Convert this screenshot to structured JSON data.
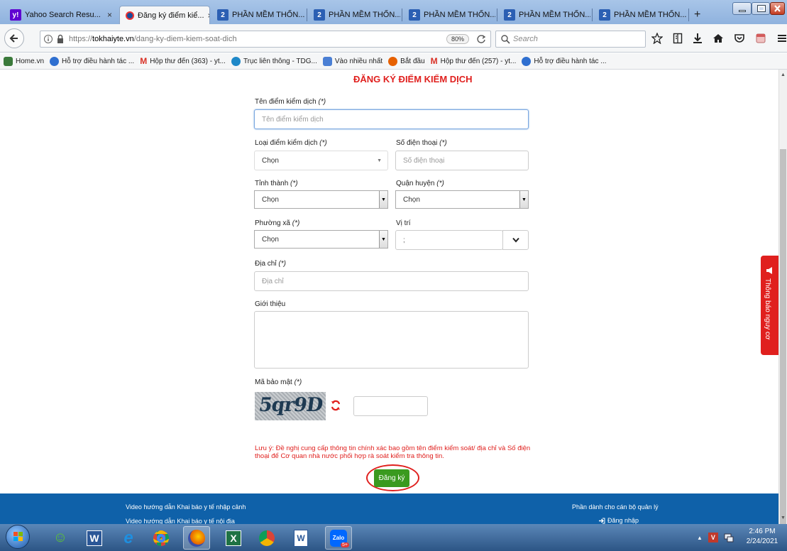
{
  "browser": {
    "tabs": [
      {
        "label": "Yahoo Search Resu...",
        "icon": "yahoo-icon"
      },
      {
        "label": "Đăng ký điểm kiể...",
        "icon": "site-favicon"
      },
      {
        "label": "PHẦN MỀM THỐN...",
        "icon": "doc-icon"
      },
      {
        "label": "PHẦN MỀM THỐN...",
        "icon": "doc-icon"
      },
      {
        "label": "PHẦN MỀM THỐN...",
        "icon": "doc-icon"
      },
      {
        "label": "PHẦN MỀM THỐN...",
        "icon": "doc-icon"
      },
      {
        "label": "PHẦN MỀM THỐN...",
        "icon": "doc-icon"
      }
    ],
    "tab_close": "×",
    "new_tab": "+",
    "url_prefix": "https://",
    "url_host": "tokhaiyte.vn",
    "url_path": "/dang-ky-diem-kiem-soat-dich",
    "zoom": "80%",
    "search_placeholder": "Search",
    "bookmarks": [
      {
        "label": "Home.vn",
        "color": "#3b7a3b"
      },
      {
        "label": "Hỗ trợ điều hành tác ...",
        "color": "#2f6fd0"
      },
      {
        "label": "Hộp thư đến (363) - yt...",
        "color": "#d93025"
      },
      {
        "label": "Trục liên thông - TDG...",
        "color": "#1e88c8"
      },
      {
        "label": "Vào nhiều nhất",
        "color": "#4a7fd4"
      },
      {
        "label": "Bắt đầu",
        "color": "#e66000"
      },
      {
        "label": "Hộp thư đến (257) - yt...",
        "color": "#d93025"
      },
      {
        "label": "Hỗ trợ điều hành tác ...",
        "color": "#2f6fd0"
      }
    ]
  },
  "form": {
    "title": "ĐĂNG KÝ ĐIỂM KIỂM DỊCH",
    "title_color": "#e0201e",
    "name_label": "Tên điểm kiểm dịch",
    "name_placeholder": "Tên điểm kiểm dịch",
    "type_label": "Loại điểm kiểm dịch",
    "type_value": "Chọn",
    "phone_label": "Số điện thoại",
    "phone_placeholder": "Số điện thoại",
    "province_label": "Tỉnh thành",
    "province_value": "Chọn",
    "district_label": "Quận huyện",
    "district_value": "Chọn",
    "ward_label": "Phường xã",
    "ward_value": "Chọn",
    "location_label": "Vị trí",
    "location_value": ";",
    "address_label": "Địa chỉ",
    "address_placeholder": "Địa chỉ",
    "intro_label": "Giới thiệu",
    "captcha_label": "Mã bảo mật",
    "captcha_text": "5qr9D",
    "required_mark": "(*)",
    "note": "Lưu ý: Đề nghị cung cấp thông tin chính xác bao gồm tên điểm kiểm soát/ địa chỉ và Số điện thoại để Cơ quan nhà nước phối hợp rà soát kiểm tra thông tin.",
    "submit_label": "Đăng ký",
    "submit_color": "#3a9a1f"
  },
  "side_tab": {
    "label": "Thông báo nguy cơ",
    "color": "#e0201e"
  },
  "footer": {
    "link_1": "Video hướng dẫn Khai báo y tế nhập cảnh",
    "link_2": "Video hướng dẫn Khai báo y tế nội địa",
    "admin_title": "Phần dành cho cán bộ quản lý",
    "login": "Đăng nhập",
    "color": "#0f61a9"
  },
  "taskbar": {
    "apps": [
      "windows-start",
      "app-icon",
      "word-icon",
      "ie-icon",
      "chrome-icon",
      "firefox-icon",
      "excel-icon",
      "chrome-icon",
      "word-doc-icon",
      "zalo-icon"
    ],
    "time": "2:46 PM",
    "date": "2/24/2021",
    "zalo_badge": "5+"
  }
}
